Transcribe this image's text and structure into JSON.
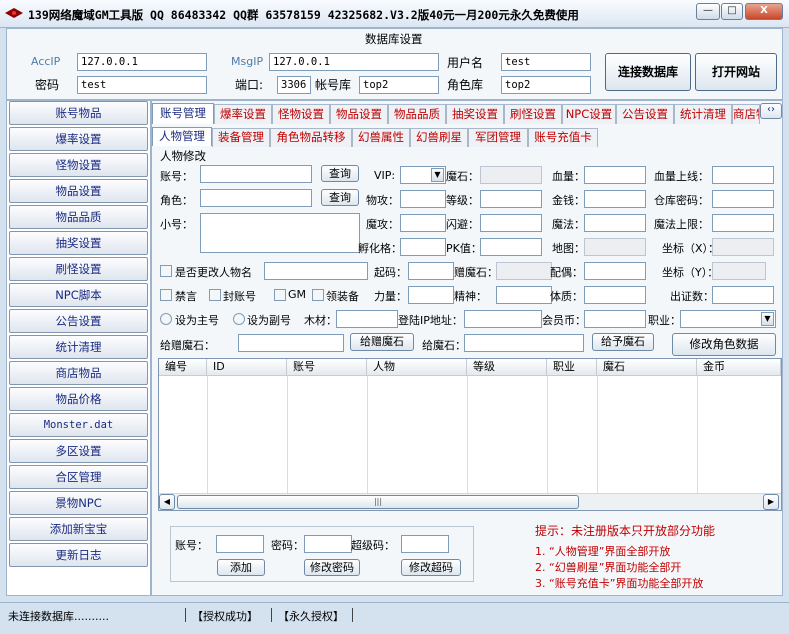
{
  "window": {
    "title": "139网络魔域GM工具版 QQ 86483342 QQ群 63578159 42325682.V3.2版40元一月200元永久免费使用",
    "controls": {
      "minimize": "—",
      "maximize": "□",
      "close": "X"
    }
  },
  "db": {
    "title": "数据库设置",
    "acc_ip_label": "AccIP",
    "acc_ip": "127.0.0.1",
    "msg_ip_label": "MsgIP",
    "msg_ip": "127.0.0.1",
    "user_label": "用户名",
    "user": "test",
    "password_label": "密码",
    "password": "test",
    "port_label": "端口:",
    "port": "3306",
    "account_db_label": "帐号库",
    "account_db": "top2",
    "role_db_label": "角色库",
    "role_db": "top2",
    "connect_btn": "连接数据库",
    "open_site_btn": "打开网站"
  },
  "sidebar": {
    "items": [
      "账号物品",
      "爆率设置",
      "怪物设置",
      "物品设置",
      "物品品质",
      "抽奖设置",
      "刷怪设置",
      "NPC脚本",
      "公告设置",
      "统计清理",
      "商店物品",
      "物品价格",
      "Monster.dat",
      "多区设置",
      "合区管理",
      "景物NPC",
      "添加新宝宝",
      "更新日志"
    ]
  },
  "tabs": {
    "main": [
      "账号管理",
      "爆率设置",
      "怪物设置",
      "物品设置",
      "物品品质",
      "抽奖设置",
      "刷怪设置",
      "NPC设置",
      "公告设置",
      "统计清理",
      "商店物品"
    ],
    "sub": [
      "人物管理",
      "装备管理",
      "角色物品转移",
      "幻兽属性",
      "幻兽刷星",
      "军团管理",
      "账号充值卡"
    ]
  },
  "form": {
    "group_title": "人物修改",
    "account": "账号：",
    "role": "角色：",
    "alt": "小号：",
    "query": "查询",
    "vip": "VIP:",
    "magic": "魔石：",
    "hp": "血量：",
    "hp_max": "血量上线：",
    "phys": "物攻：",
    "level": "等级：",
    "gold": "金钱：",
    "wh_pwd": "仓库密码：",
    "magatk": "魔攻：",
    "dodge": "闪避：",
    "mp": "魔法：",
    "mp_max": "魔法上限：",
    "hatch": "孵化格：",
    "pk": "PK值：",
    "map": "地图：",
    "coord_x": "坐标（X）：",
    "rename_chk": "是否更改人物名",
    "start_code": "起码：",
    "gift_magic": "赠魔石：",
    "spouse": "配偶：",
    "coord_y": "坐标（Y）：",
    "ban_talk": "禁言",
    "ban_acc": "封账号",
    "gm": "GM",
    "equip": "领装备",
    "power": "力量：",
    "spirit": "精神：",
    "physique": "体质：",
    "place": "出证数：",
    "set_main": "设为主号",
    "set_alt": "设为副号",
    "wood": "木材：",
    "login_ip": "登陆IP地址：",
    "member": "会员币：",
    "job": "职业：",
    "give_magic_lbl": "给赠魔石：",
    "give_magic_btn": "给赠魔石",
    "give_magic2_lbl": "给魔石：",
    "give_magic2_btn": "给予魔石",
    "modify_role": "修改角色数据"
  },
  "table": {
    "columns": [
      "编号",
      "ID",
      "账号",
      "人物",
      "等级",
      "职业",
      "魔石",
      "金币"
    ]
  },
  "bottom": {
    "account": "账号：",
    "password": "密码：",
    "super": "超级码：",
    "add": "添加",
    "mod_pwd": "修改密码",
    "mod_super": "修改超码"
  },
  "tips": {
    "title": "提示：未注册版本只开放部分功能",
    "t1": "1. “人物管理”界面全部开放",
    "t2": "2. “幻兽刷星”界面功能全部开",
    "t3": "3. “账号充值卡”界面功能全部开放"
  },
  "status": {
    "conn": "未连接数据库..........",
    "auth": "【授权成功】",
    "perm": "【永久授权】"
  },
  "colors": {
    "accent_red": "#c00000",
    "label_blue": "#4f7ca8",
    "nav_text": "#1a2b80"
  }
}
